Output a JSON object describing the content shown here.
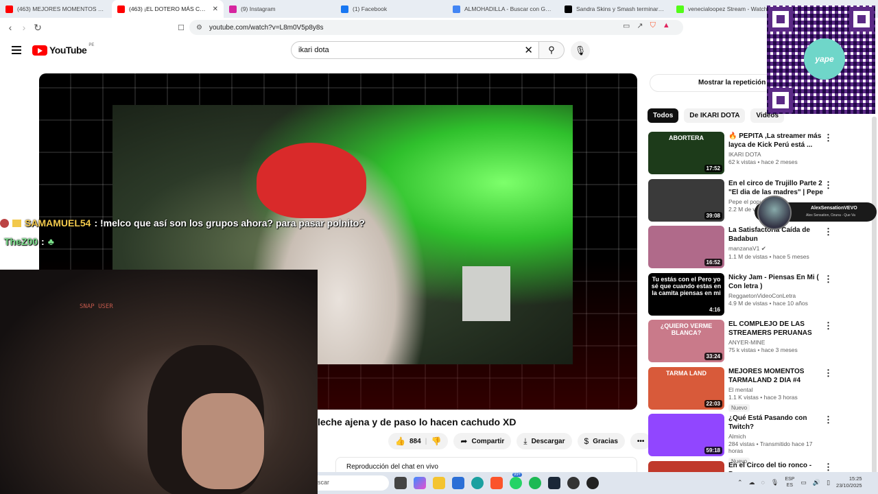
{
  "browser": {
    "tabs": [
      {
        "label": "(463) MEJORES MOMENTOS TARMA",
        "favicon_color": "#ff0000",
        "active": false
      },
      {
        "label": "(463) ¡EL DOTERO MÁS CACHUDO",
        "favicon_color": "#ff0000",
        "active": true
      },
      {
        "label": "(9) Instagram",
        "favicon_color": "#d6249f",
        "active": false
      },
      {
        "label": "(1) Facebook",
        "favicon_color": "#1877f2",
        "active": false
      },
      {
        "label": "ALMOHADILLA - Buscar con Google",
        "favicon_color": "#4285f4",
        "active": false
      },
      {
        "label": "Sandra Skins y Smash terminaron su",
        "favicon_color": "#000000",
        "active": false
      },
      {
        "label": "venecialoopez Stream - Watch",
        "favicon_color": "#53fc18",
        "active": false
      }
    ],
    "url": "youtube.com/watch?v=L8m0V5p8y8s"
  },
  "youtube": {
    "logo_text": "YouTube",
    "country_code": "PE",
    "search_query": "ikari dota"
  },
  "player": {
    "chat_lines": [
      {
        "user": "SAMAMUEL54",
        "message": ": !melco que así son los grupos ahora? para pasar polnito?"
      },
      {
        "user": "TheZ00",
        "message": ":"
      }
    ],
    "webcam_label": "SNAP USER"
  },
  "video": {
    "title": "leche ajena y de paso lo hacen cachudo XD",
    "likes": "884",
    "share_label": "Compartir",
    "download_label": "Descargar",
    "thanks_label": "Gracias",
    "live_chat_replay": "Reproducción del chat en vivo"
  },
  "sidebar": {
    "show_replay": "Mostrar la repetición d",
    "chips": [
      "Todos",
      "De IKARI DOTA",
      "Videos"
    ],
    "recommendations": [
      {
        "title": "🔥 PEPITA ,La streamer más layca de Kick Perú está ...",
        "channel": "IKARI DOTA",
        "meta": "62 k vistas • hace 2 meses",
        "duration": "17:52",
        "thumb_text": "ABORTERA",
        "thumb_color": "#1d3b1a",
        "badge": ""
      },
      {
        "title": "En el circo de Trujillo Parte 2 \"El dia de las madres\" | Pepe el ...",
        "channel": "Pepe el popu",
        "meta": "2.2 M de v",
        "duration": "39:08",
        "thumb_text": "",
        "thumb_color": "#3a3a3a",
        "badge": ""
      },
      {
        "title": "La Satisfactoria Caída de Badabun",
        "channel": "manzanaV1 ✔",
        "meta": "1.1 M de vistas • hace 5 meses",
        "duration": "16:52",
        "thumb_text": "",
        "thumb_color": "#b06a8a",
        "badge": ""
      },
      {
        "title": "Nicky Jam - Piensas En Mi ( Con letra )",
        "channel": "ReggaetonVideoConLetra",
        "meta": "4.9 M de vistas • hace 10 años",
        "duration": "4:16",
        "thumb_text": "Tu estás con el Pero yo sé que cuando estas en la camita piensas en mi",
        "thumb_color": "#000000",
        "badge": ""
      },
      {
        "title": "EL COMPLEJO DE LAS STREAMERS PERUANAS CON ...",
        "channel": "ANYER-MINE",
        "meta": "75 k vistas • hace 3 meses",
        "duration": "33:24",
        "thumb_text": "¿QUIERO VERME BLANCA?",
        "thumb_color": "#c97a8a",
        "badge": ""
      },
      {
        "title": "MEJORES MOMENTOS TARMALAND 2 DIA #4",
        "channel": "El mental",
        "meta": "1.1 K vistas • hace 3 horas",
        "duration": "22:03",
        "thumb_text": "TARMA LAND",
        "thumb_color": "#d85a3a",
        "badge": "Nuevo"
      },
      {
        "title": "¿Qué Está Pasando con Twitch?",
        "channel": "Almich",
        "meta": "284 vistas • Transmitido hace 17 horas",
        "duration": "59:18",
        "thumb_text": "",
        "thumb_color": "#9146ff",
        "badge": "Nuevo"
      },
      {
        "title": "En el Circo del tio ronco - Pepe",
        "channel": "",
        "meta": "",
        "duration": "",
        "thumb_text": "",
        "thumb_color": "#c0392b",
        "badge": ""
      }
    ]
  },
  "overlays": {
    "qr_brand": "yape",
    "now_playing": {
      "artist": "AlexSensationVEVO",
      "song": "Alex Sensation, Ozuna - Que Va"
    }
  },
  "taskbar": {
    "search_placeholder": "scar",
    "notification_count": "99+",
    "language": "ESP",
    "language_sub": "ES",
    "time": "15:25",
    "date": "23/10/2025"
  }
}
